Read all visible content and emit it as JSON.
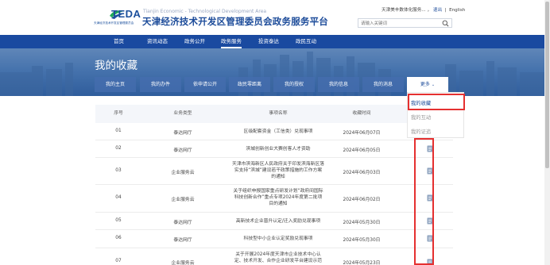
{
  "header": {
    "logo_text": "TEDA",
    "logo_sub": "天津经济技术开发区管理委员会",
    "site_title_en": "Tianjin Economic - Technological Development Area",
    "site_title": "天津经济技术开发区管理委员会政务服务平台",
    "user_greeting": "天津美丰数体化服务...",
    "logout": "退出",
    "language": "English",
    "search_placeholder": "请输入关键词"
  },
  "nav": {
    "items": [
      "首页",
      "资讯动态",
      "政务公开",
      "政务服务",
      "投资泰达",
      "政民互动"
    ],
    "active_index": 3
  },
  "banner": {
    "title": "我的收藏"
  },
  "tabs": {
    "items": [
      "我的主页",
      "我的办件",
      "依申请公开",
      "政民零距离",
      "我的授权",
      "我的信息",
      "我的消息"
    ],
    "more": "更多"
  },
  "dropdown": {
    "items": [
      "我的收藏",
      "我的互动",
      "我的证追"
    ],
    "active_index": 0
  },
  "table": {
    "columns": [
      "序号",
      "业务类型",
      "事项名称",
      "收藏时间",
      "操作"
    ],
    "rows": [
      {
        "no": "01",
        "type": "泰达网厅",
        "name": "区级配套资金（工信类）兑现事项",
        "time": "2024年06月07日",
        "has_icon": false
      },
      {
        "no": "02",
        "type": "泰达网厅",
        "name": "滨城创新创业大赛创客人才资助",
        "time": "2024年06月05日",
        "has_icon": true
      },
      {
        "no": "03",
        "type": "企业服务云",
        "name": "天津市滨海新区人民政府关于印发滨海新区落实支持“滨城”建设若干政策措施的工作方案的通知",
        "time": "2024年06月03日",
        "has_icon": true
      },
      {
        "no": "04",
        "type": "企业服务云",
        "name": "关于组织申报国家重点研发计划“政府间国际科技创新合作”重点专项2024年度第二批项目的通知",
        "time": "2024年06月02日",
        "has_icon": true
      },
      {
        "no": "05",
        "type": "泰达网厅",
        "name": "高新技术企业晋升认定/迁入奖励兑现事项",
        "time": "2024年05月30日",
        "has_icon": true
      },
      {
        "no": "06",
        "type": "泰达网厅",
        "name": "科技型中小企业认定奖励兑现事项",
        "time": "2024年05月30日",
        "has_icon": true
      },
      {
        "no": "07",
        "type": "企业服务云",
        "name": "关于开展2024年度天津市企业技术中心认定、技术开发、合作企业研发平台建设示范",
        "time": "2024年05月23日",
        "has_icon": true
      }
    ]
  },
  "colors": {
    "nav_bg": "#1a4aa0",
    "brand_blue": "#1d4c9a",
    "highlight_red": "#e53030"
  }
}
